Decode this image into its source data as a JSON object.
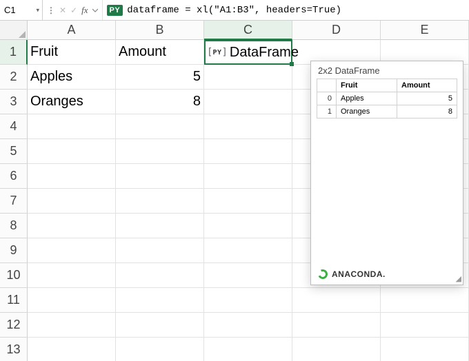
{
  "formula_bar": {
    "cell_ref": "C1",
    "py_badge": "PY",
    "code": "dataframe = xl(\"A1:B3\", headers=True)"
  },
  "columns": [
    "A",
    "B",
    "C",
    "D",
    "E"
  ],
  "rows": [
    "1",
    "2",
    "3",
    "4",
    "5",
    "6",
    "7",
    "8",
    "9",
    "10",
    "11",
    "12",
    "13"
  ],
  "selected_col_index": 2,
  "selected_row_index": 0,
  "cells": {
    "A1": "Fruit",
    "B1": "Amount",
    "C1": {
      "badge": "PY",
      "text": "DataFrame"
    },
    "A2": "Apples",
    "B2": "5",
    "A3": "Oranges",
    "B3": "8"
  },
  "popup": {
    "title": "2x2 DataFrame",
    "headers": [
      "",
      "Fruit",
      "Amount"
    ],
    "rows": [
      {
        "index": "0",
        "fruit": "Apples",
        "amount": "5"
      },
      {
        "index": "1",
        "fruit": "Oranges",
        "amount": "8"
      }
    ],
    "footer_brand": "ANACONDA."
  },
  "chart_data": {
    "type": "table",
    "title": "2x2 DataFrame",
    "columns": [
      "Fruit",
      "Amount"
    ],
    "index": [
      0,
      1
    ],
    "rows": [
      [
        "Apples",
        5
      ],
      [
        "Oranges",
        8
      ]
    ]
  }
}
